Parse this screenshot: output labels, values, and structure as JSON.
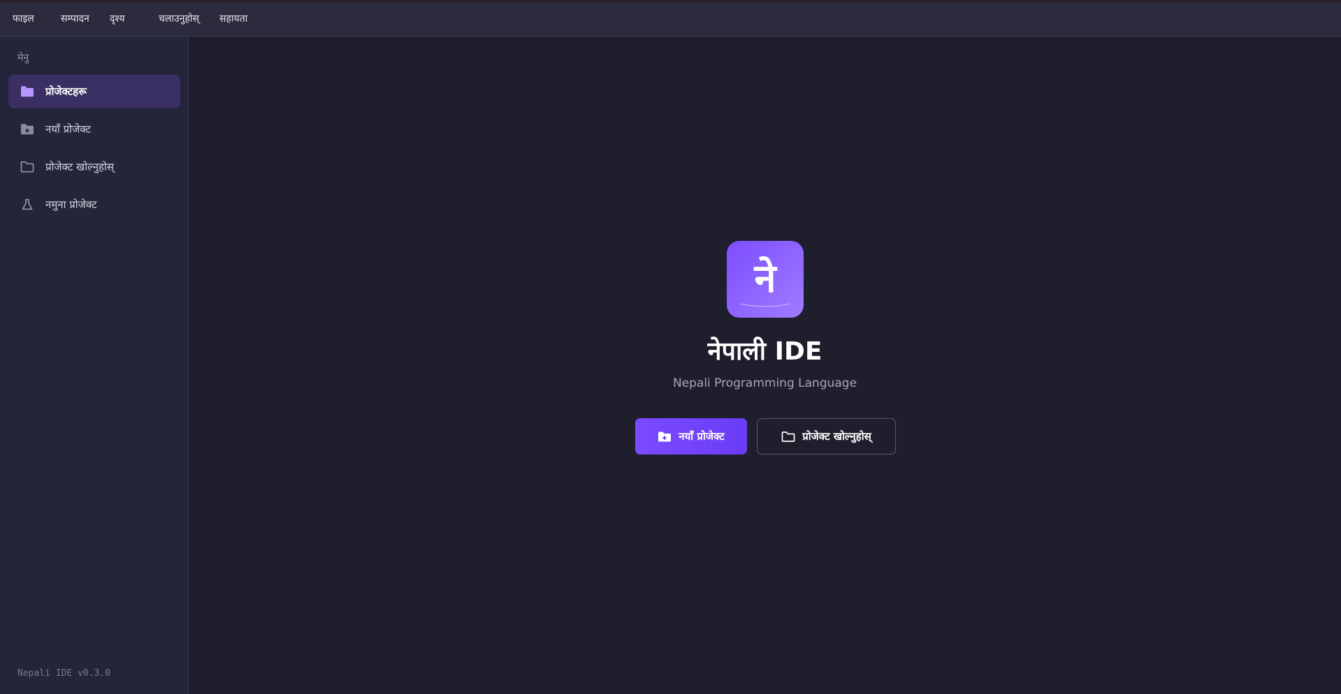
{
  "menubar": {
    "items": [
      {
        "label": "फाइल"
      },
      {
        "label": "सम्पादन"
      },
      {
        "label": "दृश्य"
      },
      {
        "label": "चलाउनुहोस्"
      },
      {
        "label": "सहायता"
      }
    ]
  },
  "sidebar": {
    "heading": "मेनु",
    "items": [
      {
        "label": "प्रोजेक्टहरू",
        "icon": "folder-filled-icon",
        "active": true
      },
      {
        "label": "नयाँ प्रोजेक्ट",
        "icon": "folder-plus-icon",
        "active": false
      },
      {
        "label": "प्रोजेक्ट खोल्नुहोस्",
        "icon": "folder-outline-icon",
        "active": false
      },
      {
        "label": "नमुना प्रोजेक्ट",
        "icon": "flask-icon",
        "active": false
      }
    ],
    "version": "Nepali IDE v0.3.0"
  },
  "welcome": {
    "logo_glyph": "ने",
    "title": "नेपाली IDE",
    "subtitle": "Nepali Programming Language",
    "primary_button": "नयाँ प्रोजेक्ट",
    "secondary_button": "प्रोजेक्ट खोल्नुहोस्"
  },
  "colors": {
    "accent": "#7c4dff",
    "background": "#1e1e2c",
    "sidebar": "#24243a",
    "menubar": "#2b2b3d"
  }
}
